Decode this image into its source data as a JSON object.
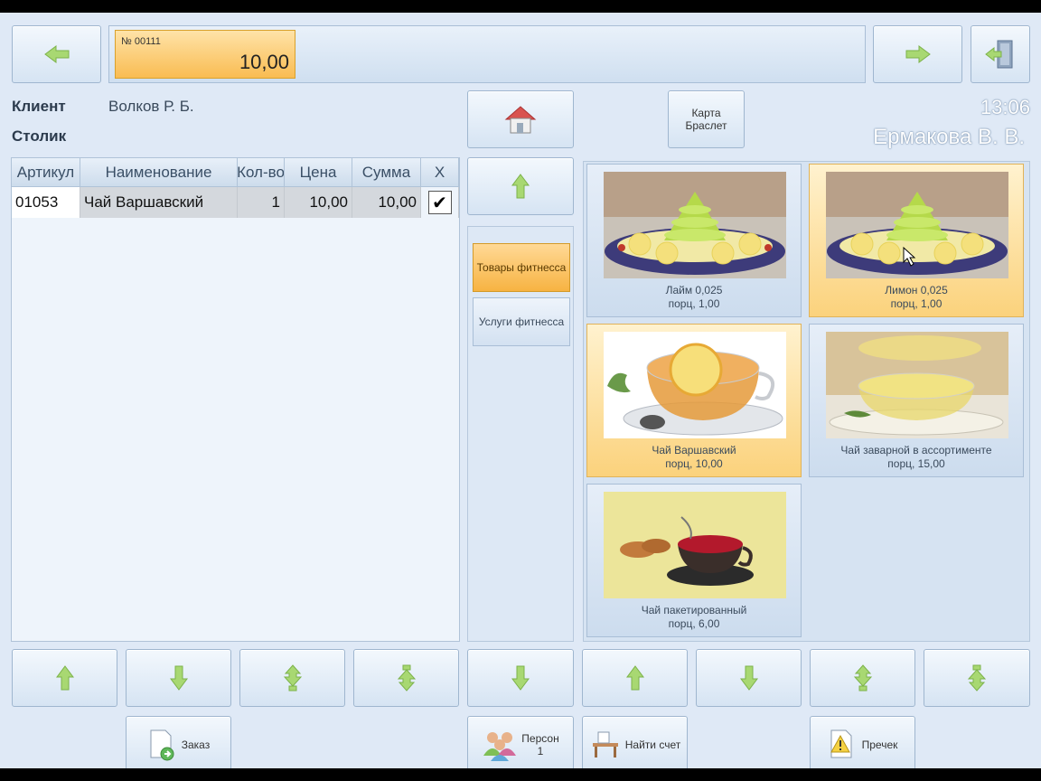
{
  "order": {
    "number": "№ 00111",
    "total": "10,00"
  },
  "client": {
    "label": "Клиент",
    "value": "Волков Р. Б."
  },
  "table": {
    "label": "Столик"
  },
  "clock": "13:06",
  "waiter": "Ермакова В. В.",
  "card_button": {
    "line1": "Карта",
    "line2": "Браслет"
  },
  "grid": {
    "columns": [
      "Артикул",
      "Наименование",
      "Кол-во",
      "Цена",
      "Сумма",
      "X"
    ],
    "rows": [
      {
        "article": "01053",
        "name": "Чай Варшавский",
        "qty": "1",
        "price": "10,00",
        "sum": "10,00",
        "checked": true
      }
    ]
  },
  "categories": [
    {
      "label": "Товары фитнесса",
      "active": true
    },
    {
      "label": "Услуги фитнесса",
      "active": false
    }
  ],
  "products": [
    {
      "name": "Лайм 0,025",
      "price": "порц, 1,00",
      "selected": false
    },
    {
      "name": "Лимон 0,025",
      "price": "порц, 1,00",
      "selected": true
    },
    {
      "name": "Чай Варшавский",
      "price": "порц, 10,00",
      "selected": true
    },
    {
      "name": "Чай заварной в ассортименте",
      "price": "порц, 15,00",
      "selected": false
    },
    {
      "name": "Чай пакетированный",
      "price": "порц, 6,00",
      "selected": false
    }
  ],
  "bottom_buttons": {
    "order": "Заказ",
    "persons": "Персон",
    "persons_count": "1",
    "find_bill": "Найти счет",
    "precheck": "Пречек"
  },
  "colors": {
    "accent": "#f9bc52",
    "arrow_green": "#8ccf5a",
    "background": "#dfe9f6"
  }
}
